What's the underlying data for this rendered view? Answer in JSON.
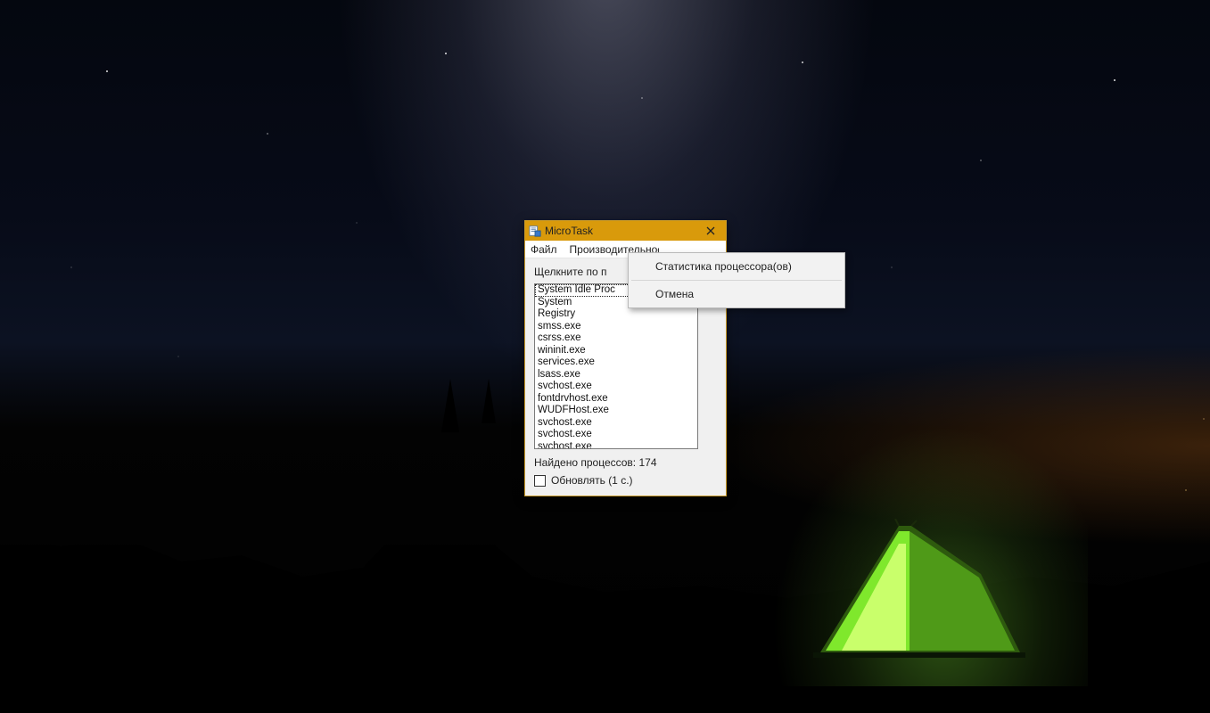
{
  "window": {
    "title": "MicroTask"
  },
  "menubar": {
    "items": [
      {
        "label": "Файл"
      },
      {
        "label": "Производительность"
      }
    ]
  },
  "hint_label": "Щелкните по п",
  "processes": [
    "System Idle Proc",
    "System",
    "Registry",
    "smss.exe",
    "csrss.exe",
    "wininit.exe",
    "services.exe",
    "lsass.exe",
    "svchost.exe",
    "fontdrvhost.exe",
    "WUDFHost.exe",
    "svchost.exe",
    "svchost.exe",
    "svchost.exe"
  ],
  "selected_index": 0,
  "status": {
    "found_label": "Найдено процессов:",
    "found_count": "174"
  },
  "refresh": {
    "label": "Обновлять (1 с.)",
    "checked": false
  },
  "popup": {
    "items": [
      "Статистика процессора(ов)",
      "Отмена"
    ]
  }
}
